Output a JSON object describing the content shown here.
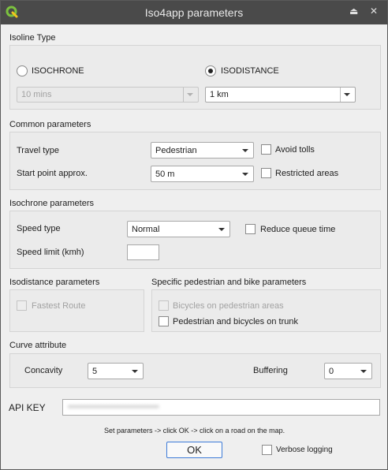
{
  "window": {
    "title": "Iso4app parameters",
    "minimize_glyph": "⏏",
    "close_glyph": "✕",
    "app_icon": "qgis-logo-icon"
  },
  "isoline": {
    "heading": "Isoline Type",
    "isochrone_label": "ISOCHRONE",
    "isodistance_label": "ISODISTANCE",
    "selected": "ISODISTANCE",
    "isochrone_value": "10 mins",
    "isodistance_value": "1 km"
  },
  "common": {
    "heading": "Common parameters",
    "travel_type_label": "Travel type",
    "travel_type_value": "Pedestrian",
    "avoid_tolls_label": "Avoid tolls",
    "avoid_tolls_checked": false,
    "start_point_label": "Start point approx.",
    "start_point_value": "50 m",
    "restricted_label": "Restricted areas",
    "restricted_checked": false
  },
  "isochrone": {
    "heading": "Isochrone parameters",
    "speed_type_label": "Speed type",
    "speed_type_value": "Normal",
    "reduce_queue_label": "Reduce queue time",
    "reduce_queue_checked": false,
    "speed_limit_label": "Speed limit (kmh)",
    "speed_limit_value": ""
  },
  "isodistance": {
    "heading": "Isodistance parameters",
    "fastest_route_label": "Fastest Route"
  },
  "pedbike": {
    "heading": "Specific pedestrian and bike parameters",
    "bicycles_ped_label": "Bicycles on pedestrian areas",
    "ped_trunk_label": "Pedestrian and bicycles on trunk",
    "ped_trunk_checked": false
  },
  "curve": {
    "heading": "Curve attribute",
    "concavity_label": "Concavity",
    "concavity_value": "5",
    "buffering_label": "Buffering",
    "buffering_value": "0"
  },
  "api": {
    "label": "API KEY",
    "value_redacted": "•••••••••••••••••••••••••••••••••"
  },
  "footer": {
    "hint": "Set parameters -> click OK -> click on a road on the map.",
    "ok_label": "OK",
    "verbose_label": "Verbose logging",
    "verbose_checked": false
  }
}
